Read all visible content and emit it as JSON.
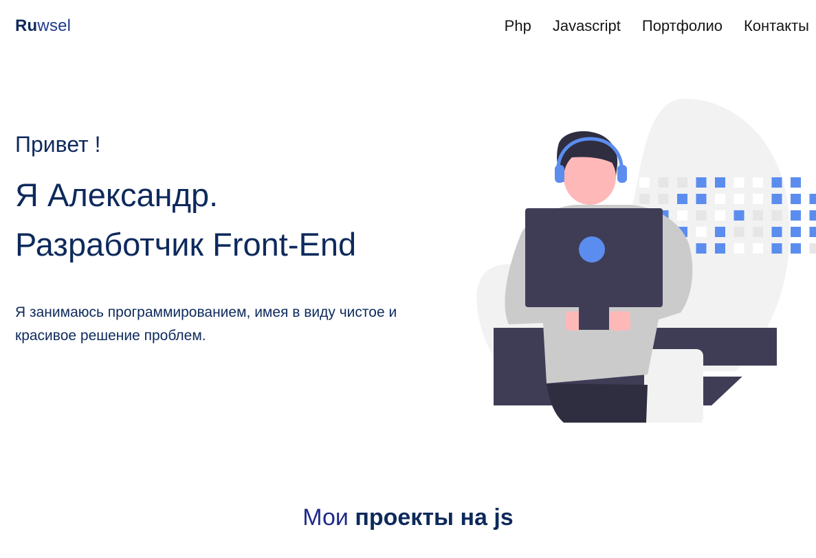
{
  "header": {
    "logo_bold": "Ru",
    "logo_light": "wsel",
    "nav": [
      {
        "label": "Php"
      },
      {
        "label": "Javascript"
      },
      {
        "label": "Портфолио"
      },
      {
        "label": "Контакты"
      }
    ]
  },
  "hero": {
    "greeting": "Привет !",
    "title_line1": "Я Александр.",
    "title_line2": "Разработчик Front-End",
    "description": "Я занимаюсь программированием, имея в виду чистое и красивое решение проблем."
  },
  "illustration": {
    "icon": "developer-at-computer-illustration",
    "colors": {
      "blob": "#f2f2f2",
      "accent": "#5b8def",
      "dark": "#3f3d56",
      "skin": "#ffb8b8",
      "hair": "#2f2e41",
      "shirt": "#cbcbcb",
      "grid_light": "#e6e6e6"
    }
  },
  "projects": {
    "title_light": "Мои",
    "title_bold": "проекты на js"
  }
}
